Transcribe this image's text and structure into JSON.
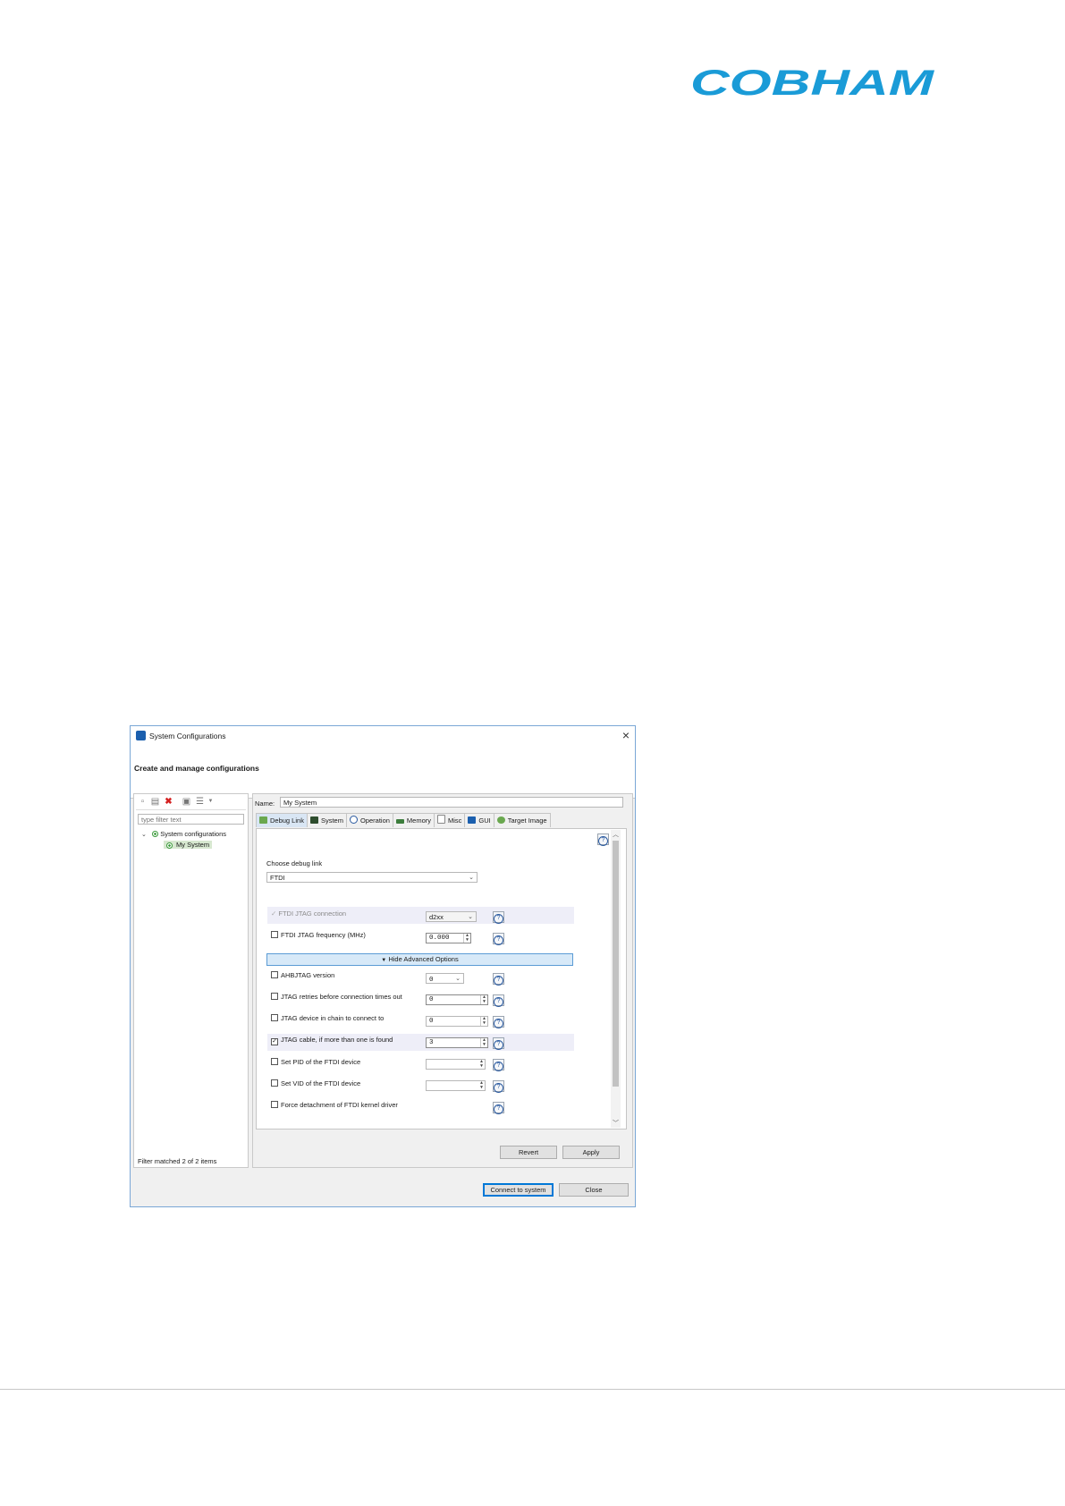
{
  "page": {
    "logo_text": "COBHAM",
    "brand_color": "#1a9bd7"
  },
  "dialog": {
    "title": "System Configurations",
    "close_icon": "×",
    "header_title": "Create and manage configurations",
    "left": {
      "filter_placeholder": "type filter text",
      "tree_root": "System configurations",
      "tree_child": "My System",
      "status": "Filter matched 2 of 2 items",
      "toolbar_icons": [
        "new-config-icon",
        "duplicate-icon",
        "delete-icon",
        "collapse-icon",
        "filter-icon"
      ]
    },
    "right": {
      "name_label": "Name:",
      "name_value": "My System",
      "tabs": [
        "Debug Link",
        "System",
        "Operation",
        "Memory",
        "Misc",
        "GUI",
        "Target Image"
      ],
      "choose_label": "Choose debug link",
      "debug_link_value": "FTDI",
      "help_glyph": "?",
      "options": {
        "jtag_conn_label": "FTDI JTAG connection",
        "jtag_conn_value": "d2xx",
        "jtag_freq_label": "FTDI JTAG frequency (MHz)",
        "jtag_freq_value": "0.000",
        "advanced_toggle": "Hide Advanced Options",
        "ahbjtag_label": "AHBJTAG version",
        "ahbjtag_value": "0",
        "retries_label": "JTAG retries before connection times out",
        "retries_value": "0",
        "device_chain_label": "JTAG device in chain to connect to",
        "device_chain_value": "0",
        "cable_label": "JTAG cable, if more than one is found",
        "cable_value": "3",
        "pid_label": "Set PID of the FTDI device",
        "pid_value": "",
        "vid_label": "Set VID of the FTDI device",
        "vid_value": "",
        "force_detach_label": "Force detachment of FTDI kernel driver"
      },
      "revert_label": "Revert",
      "apply_label": "Apply"
    },
    "connect_label": "Connect to system",
    "close_label": "Close"
  }
}
